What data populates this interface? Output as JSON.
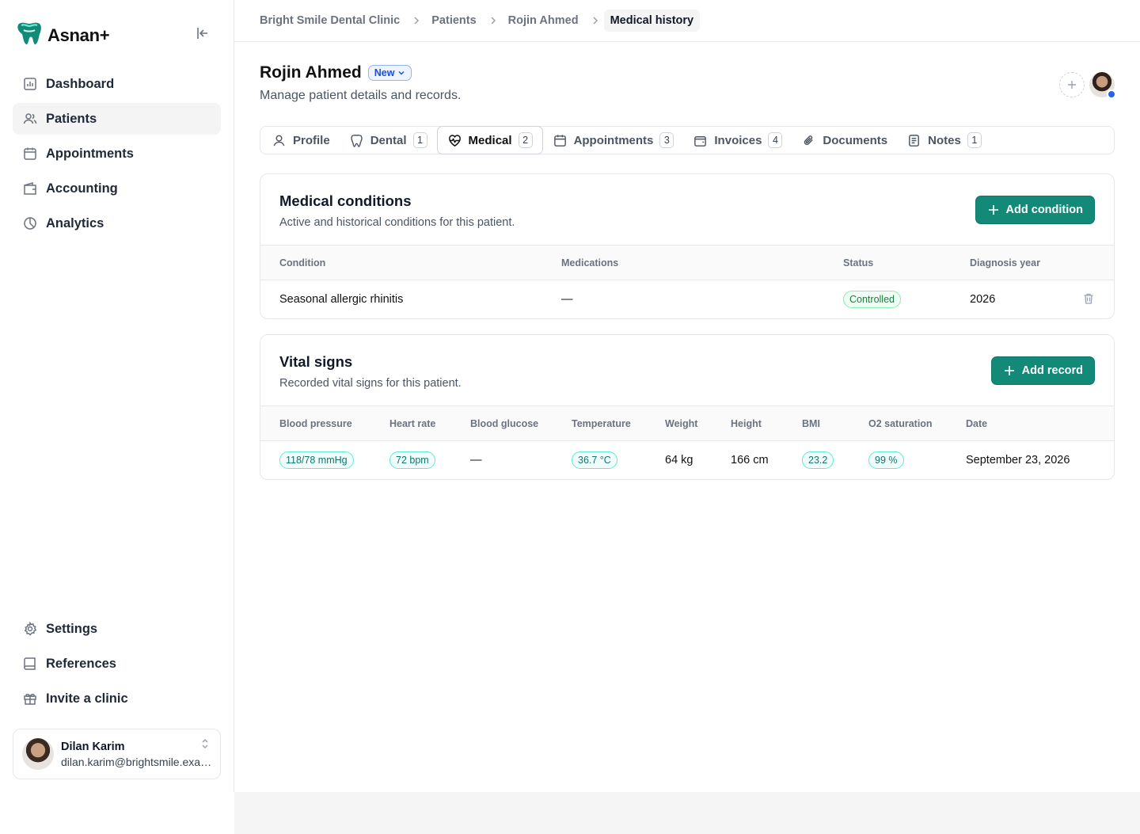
{
  "app": {
    "name": "Asnan+"
  },
  "sidebar": {
    "items": [
      {
        "label": "Dashboard"
      },
      {
        "label": "Patients"
      },
      {
        "label": "Appointments"
      },
      {
        "label": "Accounting"
      },
      {
        "label": "Analytics"
      }
    ],
    "bottom_items": [
      {
        "label": "Settings"
      },
      {
        "label": "References"
      },
      {
        "label": "Invite a clinic"
      }
    ],
    "user": {
      "name": "Dilan Karim",
      "email": "dilan.karim@brightsmile.example"
    }
  },
  "breadcrumb": [
    "Bright Smile Dental Clinic",
    "Patients",
    "Rojin Ahmed",
    "Medical history"
  ],
  "patient": {
    "name": "Rojin Ahmed",
    "status": "New",
    "subtitle": "Manage patient details and records."
  },
  "tabs": [
    {
      "label": "Profile",
      "count": "",
      "icon": "user-icon"
    },
    {
      "label": "Dental",
      "count": "1",
      "icon": "tooth-icon"
    },
    {
      "label": "Medical",
      "count": "2",
      "icon": "heart-pulse-icon",
      "active": true
    },
    {
      "label": "Appointments",
      "count": "3",
      "icon": "calendar-icon"
    },
    {
      "label": "Invoices",
      "count": "4",
      "icon": "wallet-icon"
    },
    {
      "label": "Documents",
      "count": "",
      "icon": "paperclip-icon"
    },
    {
      "label": "Notes",
      "count": "1",
      "icon": "note-icon"
    }
  ],
  "conditions": {
    "title": "Medical conditions",
    "subtitle": "Active and historical conditions for this patient.",
    "add_label": "Add condition",
    "columns": [
      "Condition",
      "Medications",
      "Status",
      "Diagnosis year"
    ],
    "rows": [
      {
        "condition": "Seasonal allergic rhinitis",
        "medications": "—",
        "status": "Controlled",
        "year": "2026"
      }
    ]
  },
  "vitals": {
    "title": "Vital signs",
    "subtitle": "Recorded vital signs for this patient.",
    "add_label": "Add record",
    "columns": [
      "Blood pressure",
      "Heart rate",
      "Blood glucose",
      "Temperature",
      "Weight",
      "Height",
      "BMI",
      "O2 saturation",
      "Date"
    ],
    "rows": [
      {
        "bp": "118/78 mmHg",
        "hr": "72 bpm",
        "glucose": "—",
        "temp": "36.7 °C",
        "weight": "64 kg",
        "height": "166 cm",
        "bmi": "23.2",
        "o2": "99 %",
        "date": "September 23, 2026"
      }
    ]
  },
  "colors": {
    "primary": "#138a78",
    "badge_blue": "#1d4ed8",
    "status_green": "#15803d"
  }
}
